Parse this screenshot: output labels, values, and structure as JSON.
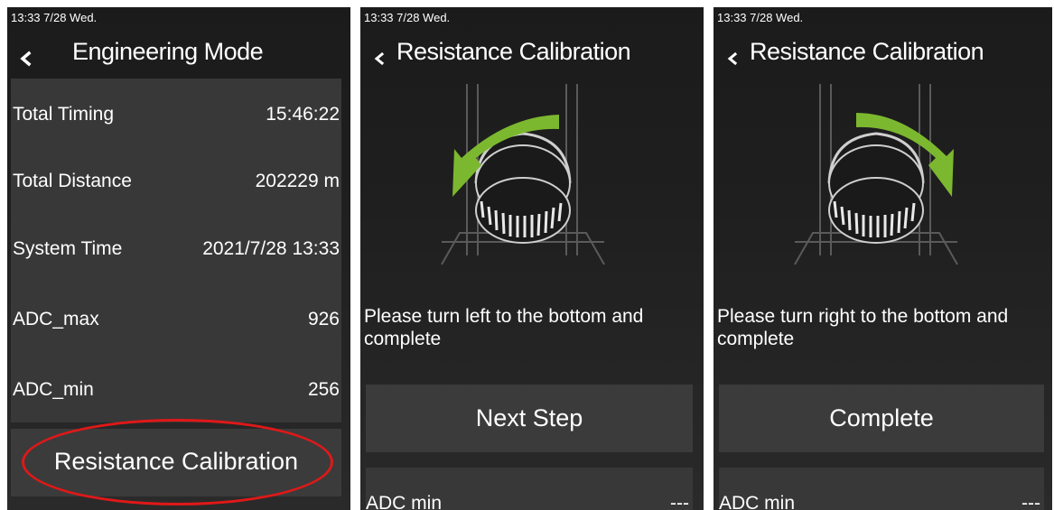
{
  "screens": [
    {
      "status": "13:33 7/28 Wed.",
      "title": "Engineering Mode",
      "rows": [
        {
          "label": "Total Timing",
          "value": "15:46:22"
        },
        {
          "label": "Total Distance",
          "value": "202229 m"
        },
        {
          "label": "System Time",
          "value": "2021/7/28 13:33"
        },
        {
          "label": "ADC_max",
          "value": "926"
        },
        {
          "label": "ADC_min",
          "value": "256"
        }
      ],
      "button": "Resistance Calibration"
    },
    {
      "status": "13:33 7/28 Wed.",
      "title": "Resistance Calibration",
      "instruction": "Please turn left to the bottom and complete",
      "button": "Next Step",
      "adc_label": "ADC min",
      "adc_value": "---",
      "arrow_direction": "counterclockwise"
    },
    {
      "status": "13:33 7/28 Wed.",
      "title": "Resistance Calibration",
      "instruction": "Please turn right to the bottom and complete",
      "button": "Complete",
      "adc_label": "ADC min",
      "adc_value": "---",
      "arrow_direction": "clockwise"
    }
  ],
  "colors": {
    "background": "#1f1f1f",
    "panel": "#383838",
    "arrow": "#7cb82f",
    "highlight": "#e01818",
    "text": "#ffffff"
  },
  "icons": {
    "back": "chevron-left-icon",
    "knob": "resistance-knob-icon",
    "arrow": "rotation-arrow-icon"
  }
}
